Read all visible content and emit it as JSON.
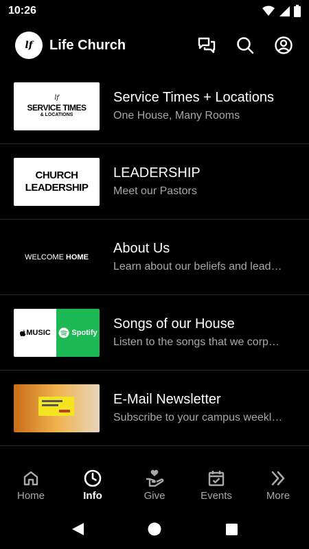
{
  "status_bar": {
    "time": "10:26"
  },
  "app": {
    "title": "Life Church",
    "logo_text": "lf"
  },
  "items": [
    {
      "title": "Service Times + Locations",
      "subtitle": "One House, Many Rooms",
      "thumb_lines": [
        "lf",
        "SERVICE TIMES",
        "& LOCATIONS"
      ]
    },
    {
      "title": "LEADERSHIP",
      "subtitle": "Meet our Pastors",
      "thumb_lines": [
        "CHURCH",
        "LEADERSHIP"
      ]
    },
    {
      "title": "About Us",
      "subtitle": "Learn about our beliefs and lead…",
      "thumb_lines": [
        "WELCOME",
        "HOME"
      ]
    },
    {
      "title": "Songs of our House",
      "subtitle": "Listen to the songs that we corp…",
      "thumb_lines": [
        "MUSIC",
        "Spotify"
      ]
    },
    {
      "title": "E-Mail Newsletter",
      "subtitle": "Subscribe to your campus weekl…",
      "thumb_lines": []
    }
  ],
  "bottom_nav": [
    {
      "label": "Home",
      "icon": "home-icon"
    },
    {
      "label": "Info",
      "icon": "clock-icon",
      "active": true
    },
    {
      "label": "Give",
      "icon": "give-hand-icon"
    },
    {
      "label": "Events",
      "icon": "calendar-icon"
    },
    {
      "label": "More",
      "icon": "double-chevron-icon"
    }
  ]
}
